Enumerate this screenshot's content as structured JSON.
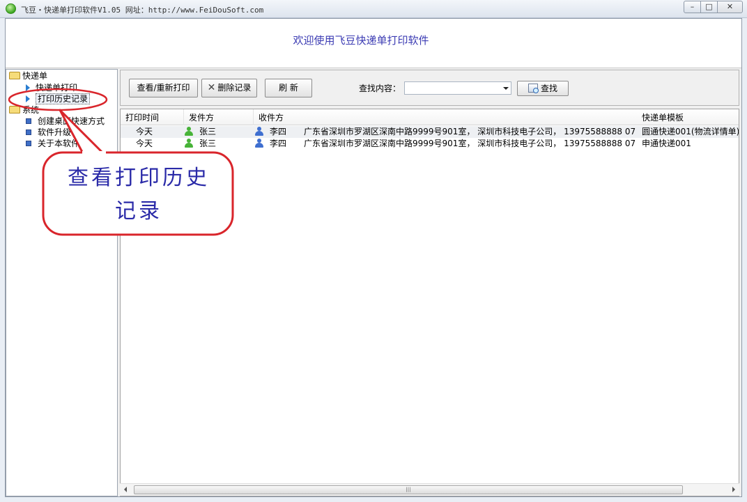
{
  "window": {
    "title": "飞豆・快递单打印软件V1.05   网址：http://www.FeiDouSoft.com",
    "min_label": "–",
    "max_label": "□",
    "close_label": "✕"
  },
  "banner": {
    "title": "欢迎使用飞豆快递单打印软件"
  },
  "tree": {
    "group1": "快递单",
    "group1_items": [
      "快递单打印",
      "打印历史记录"
    ],
    "group2": "系统",
    "group2_items": [
      "创建桌面快速方式",
      "软件升级",
      "关于本软件"
    ]
  },
  "toolbar": {
    "view_reprint": "查看/重新打印",
    "delete_records": "删除记录",
    "refresh": "刷 新",
    "search_label": "查找内容：",
    "search_value": "",
    "search_button": "查找"
  },
  "table": {
    "columns": [
      "打印时间",
      "发件方",
      "收件方",
      "快递单模板"
    ],
    "rows": [
      {
        "time": "今天",
        "sender": "张三",
        "receiver": "李四",
        "address": "广东省深圳市罗湖区深南中路9999号901室， 深圳市科技电子公司， 13975588888 07...",
        "template": "圆通快递001(物流详情单)"
      },
      {
        "time": "今天",
        "sender": "张三",
        "receiver": "李四",
        "address": "广东省深圳市罗湖区深南中路9999号901室， 深圳市科技电子公司， 13975588888 07...",
        "template": "申通快递001"
      }
    ]
  },
  "callout": {
    "line1": "查看打印历史",
    "line2": "记录"
  },
  "colors": {
    "sender_icon": "#47b338",
    "receiver_icon": "#3f6fd0",
    "callout_border": "#d9252b",
    "banner_text": "#3b3bb3"
  }
}
